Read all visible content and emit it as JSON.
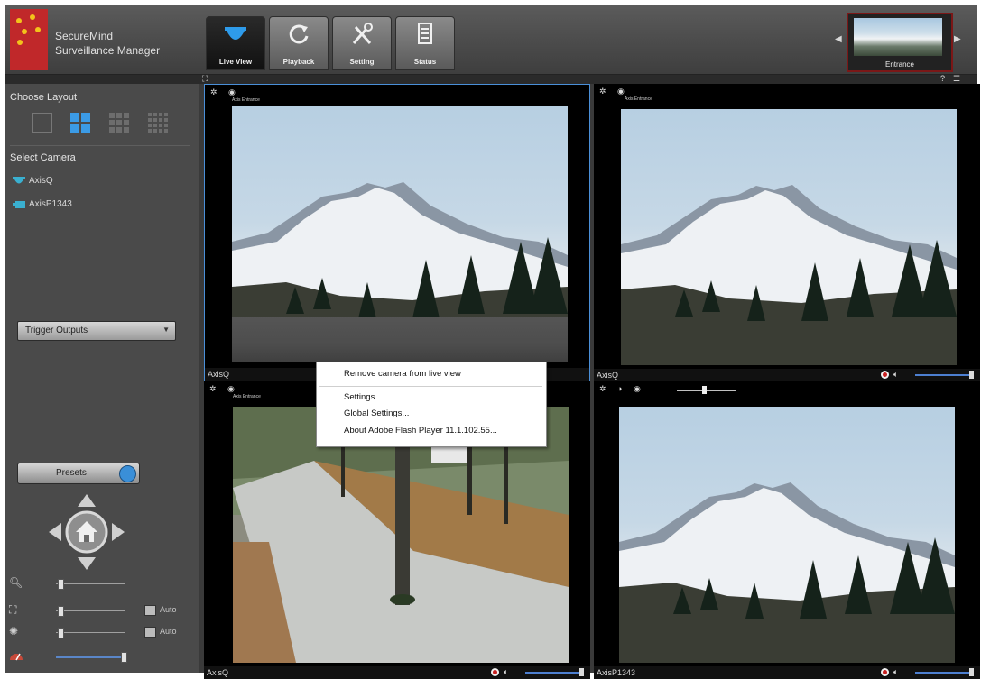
{
  "app": {
    "name_line1": "SecureMind",
    "name_line2": "Surveillance Manager"
  },
  "tabs": [
    {
      "label": "Live View",
      "icon": "camera-dome-icon",
      "active": true
    },
    {
      "label": "Playback",
      "icon": "refresh-icon",
      "active": false
    },
    {
      "label": "Setting",
      "icon": "tools-icon",
      "active": false
    },
    {
      "label": "Status",
      "icon": "document-icon",
      "active": false
    }
  ],
  "preview": {
    "label": "Entrance"
  },
  "sidebar": {
    "layout_title": "Choose Layout",
    "layout_selected": 1,
    "camera_title": "Select Camera",
    "cameras": [
      {
        "label": "AxisQ",
        "icon": "dome-camera-icon"
      },
      {
        "label": "AxisP1343",
        "icon": "box-camera-icon"
      }
    ],
    "trigger_outputs": "Trigger Outputs",
    "presets": "Presets",
    "controls": [
      {
        "icon": "zoom-icon",
        "auto": null,
        "level": 0.02
      },
      {
        "icon": "focus-icon",
        "auto": "Auto",
        "level": 0.02
      },
      {
        "icon": "iris-icon",
        "auto": "Auto",
        "level": 0.02
      },
      {
        "icon": "speed-icon",
        "auto": null,
        "level": 0.95
      }
    ]
  },
  "panes": [
    {
      "camera": "AxisQ",
      "overlay": "Axis Entrance",
      "volume": 1.0,
      "selected": true
    },
    {
      "camera": "AxisQ",
      "overlay": "Axis Entrance",
      "volume": 1.0,
      "selected": false
    },
    {
      "camera": "AxisQ",
      "overlay": "Axis Entrance",
      "volume": 1.0,
      "selected": false
    },
    {
      "camera": "AxisP1343",
      "overlay": "",
      "volume": 1.0,
      "selected": false
    }
  ],
  "context_menu": {
    "items": [
      "Remove camera from live view",
      "Settings...",
      "Global Settings...",
      "About Adobe Flash Player 11.1.102.55..."
    ]
  },
  "colors": {
    "accent": "#4a8fd8",
    "logo": "#c0282a",
    "record": "#c82020"
  }
}
